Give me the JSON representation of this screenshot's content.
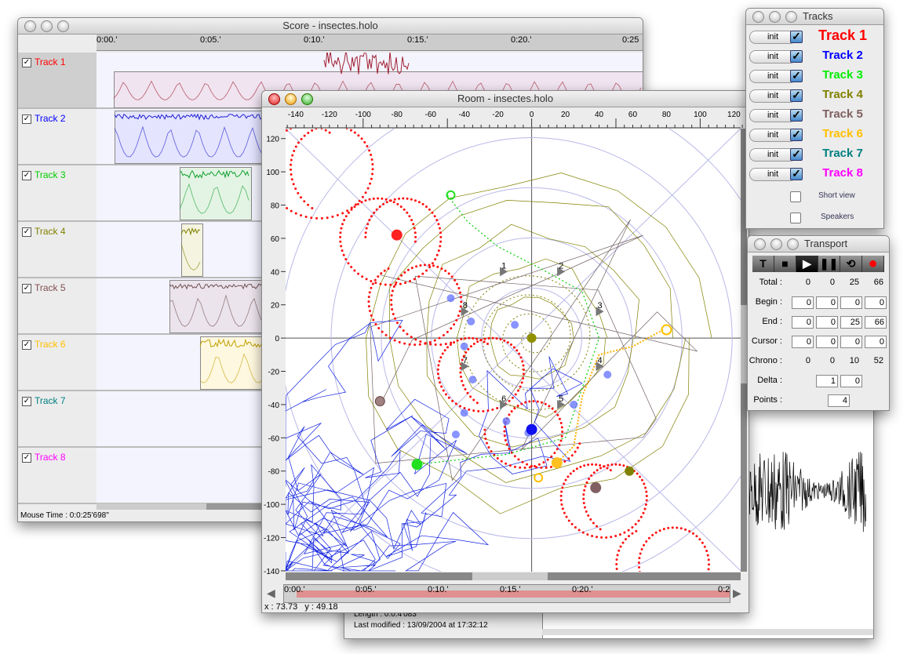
{
  "score": {
    "title": "Score - insectes.holo",
    "ruler": [
      "0:00.'",
      "0:05.'",
      "0:10.'",
      "0:15.'",
      "0:20.'",
      "0:25"
    ],
    "status": "Mouse Time : 0:0:25'698\"",
    "tracks": [
      {
        "label": "Track 1",
        "color": "#ff0000",
        "checked": true
      },
      {
        "label": "Track 2",
        "color": "#0000ff",
        "checked": true
      },
      {
        "label": "Track 3",
        "color": "#00cc00",
        "checked": true
      },
      {
        "label": "Track 4",
        "color": "#808000",
        "checked": true
      },
      {
        "label": "Track 5",
        "color": "#805050",
        "checked": true
      },
      {
        "label": "Track 6",
        "color": "#ffc000",
        "checked": true
      },
      {
        "label": "Track 7",
        "color": "#008080",
        "checked": true
      },
      {
        "label": "Track 8",
        "color": "#ff00ff",
        "checked": true
      }
    ]
  },
  "room": {
    "title": "Room - insectes.holo",
    "x_ticks": [
      -140,
      -120,
      -100,
      -80,
      -60,
      -40,
      -20,
      0,
      20,
      40,
      60,
      80,
      100,
      120
    ],
    "y_ticks": [
      120,
      100,
      80,
      60,
      40,
      20,
      0,
      -20,
      -40,
      -60,
      -80,
      -100,
      -120,
      -140
    ],
    "speakers": [
      "1",
      "2",
      "3",
      "4",
      "5",
      "6",
      "7",
      "8"
    ],
    "timeline": [
      "0:00.'",
      "0:05.'",
      "0:10.'",
      "0:15.'",
      "0:20.'",
      "0:2"
    ],
    "coords": "x : 73.73   y : 49.18"
  },
  "tracks_panel": {
    "title": "Tracks",
    "init_label": "init",
    "items": [
      {
        "label": "Track 1",
        "color": "#ff0000"
      },
      {
        "label": "Track 2",
        "color": "#0000ff"
      },
      {
        "label": "Track 3",
        "color": "#00ee00"
      },
      {
        "label": "Track 4",
        "color": "#808000"
      },
      {
        "label": "Track 5",
        "color": "#806060"
      },
      {
        "label": "Track 6",
        "color": "#ffc000"
      },
      {
        "label": "Track 7",
        "color": "#008080"
      },
      {
        "label": "Track 8",
        "color": "#ff00ff"
      }
    ],
    "short_view": {
      "label": "Short view",
      "checked": false
    },
    "speakers": {
      "label": "Speakers",
      "checked": false
    }
  },
  "transport": {
    "title": "Transport",
    "buttons": [
      {
        "name": "time",
        "glyph": "T"
      },
      {
        "name": "stop",
        "glyph": "■"
      },
      {
        "name": "play",
        "glyph": "▶"
      },
      {
        "name": "pause",
        "glyph": "❚❚"
      },
      {
        "name": "loop",
        "glyph": "⟲"
      },
      {
        "name": "record",
        "glyph": "●"
      }
    ],
    "total": {
      "label": "Total :",
      "values": [
        "0",
        "0",
        "25",
        "66"
      ]
    },
    "begin": {
      "label": "Begin :",
      "values": [
        "0",
        "0",
        "0",
        "0"
      ]
    },
    "end": {
      "label": "End :",
      "values": [
        "0",
        "0",
        "25",
        "66"
      ]
    },
    "cursor": {
      "label": "Cursor :",
      "values": [
        "0",
        "0",
        "0",
        "0"
      ]
    },
    "chrono": {
      "label": "Chrono :",
      "values": [
        "0",
        "0",
        "10",
        "52"
      ]
    },
    "delta": {
      "label": "Delta :",
      "values": [
        "1",
        "0"
      ]
    },
    "points": {
      "label": "Points :",
      "value": "4"
    }
  },
  "sound_window": {
    "length": "Length : 0:0:4'083\"",
    "modified": "Last modified : 13/09/2004 at 17:32:12"
  }
}
